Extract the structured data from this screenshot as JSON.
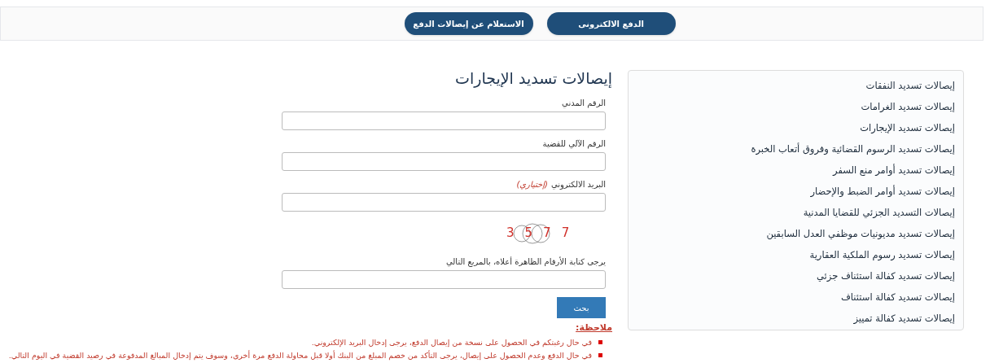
{
  "top_nav": {
    "buttons": [
      {
        "label": "الدفع الالكترونى"
      },
      {
        "label": "الاستعلام عن إيصالات الدفع"
      }
    ]
  },
  "sidebar": {
    "items": [
      {
        "label": "إيصالات تسديد النفقات"
      },
      {
        "label": "إيصالات تسديد الغرامات"
      },
      {
        "label": "إيصالات تسديد الإيجارات"
      },
      {
        "label": "إيصالات تسديد الرسوم القضائية وفروق أتعاب الخبرة"
      },
      {
        "label": "إيصالات تسديد أوامر منع السفر"
      },
      {
        "label": "إيصالات تسديد أوامر الضبط والإحضار"
      },
      {
        "label": "إيصالات التسديد الجزئي للقضايا المدنية"
      },
      {
        "label": "إيصالات تسديد مديونيات موظفي العدل السابقين"
      },
      {
        "label": "إيصالات تسديد رسوم الملكية العقارية"
      },
      {
        "label": "إيصالات تسديد كفالة استئناف جزئي"
      },
      {
        "label": "إيصالات تسديد كفالة استئناف"
      },
      {
        "label": "إيصالات تسديد كفالة تمييز"
      }
    ]
  },
  "form": {
    "title": "إيصالات تسديد الإيجارات",
    "fields": [
      {
        "label": "الرقم المدني"
      },
      {
        "label": "الرقم الآلي للقضية"
      },
      {
        "label": "البريد الالكتروني",
        "hint": "(إختياري)"
      }
    ],
    "captcha": "3577",
    "captcha_field": {
      "label": "يرجى كتابة الأرقام الظاهرة أعلاه، بالمربع التالي"
    },
    "submit": "بحث"
  },
  "notes": {
    "title": "ملاحظة:",
    "items": [
      "في حال رغبتكم في الحصول على نسخة من إيصال الدفع، يرجى إدخال البريد الإلكتروني.",
      "في حال الدفع وعدم الحصول على إيصال، يرجى التأكد من خصم المبلغ من البنك أولا قبل محاولة الدفع مرة أخرى، وسوف يتم إدخال المبالغ المدفوعة في رصيد القضية في اليوم التالي."
    ]
  }
}
